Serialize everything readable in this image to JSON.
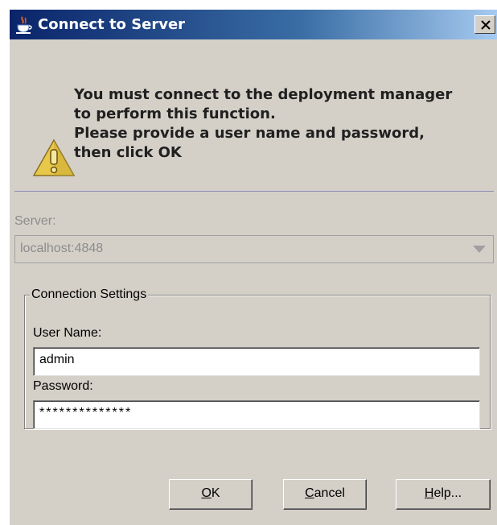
{
  "window": {
    "title": "Connect to Server",
    "title_icon": "java-cup-icon",
    "close_icon": "close-icon"
  },
  "message": {
    "icon": "warning-icon",
    "lines": [
      "You must connect to the deployment manager",
      "to perform this function.",
      "Please provide a user name and password,",
      "then click OK"
    ]
  },
  "server": {
    "label": "Server:",
    "value": "localhost:4848",
    "dropdown_icon": "chevron-down-icon"
  },
  "connection_settings": {
    "legend": "Connection Settings",
    "username_label": "User Name:",
    "username_value": "admin",
    "password_label": "Password:",
    "password_value": "**************"
  },
  "buttons": {
    "ok_mnemonic": "O",
    "ok_rest": "K",
    "cancel_mnemonic": "C",
    "cancel_rest": "ancel",
    "help_mnemonic": "H",
    "help_rest": "elp..."
  },
  "colors": {
    "title_bar_start": "#0a246a",
    "title_bar_end": "#a6caf0",
    "dialog_bg": "#d4d0c8",
    "warning_yellow": "#e8c84a"
  }
}
